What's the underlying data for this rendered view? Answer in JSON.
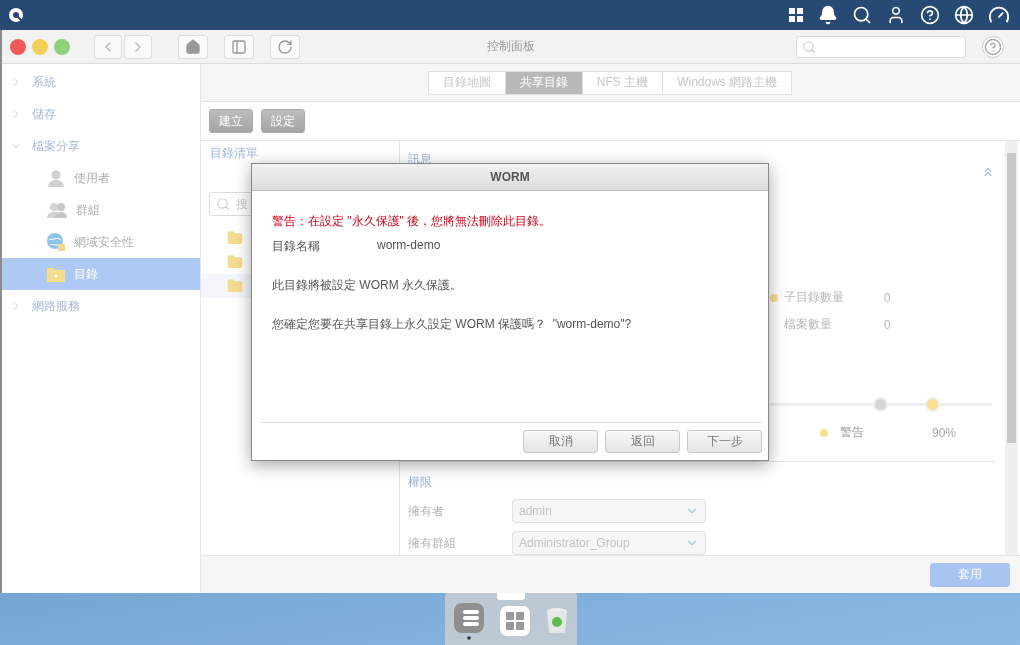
{
  "window": {
    "title": "控制面板"
  },
  "sidebar": {
    "items": [
      {
        "label": "系統",
        "expanded": false,
        "selected": false
      },
      {
        "label": "儲存",
        "expanded": false,
        "selected": false
      },
      {
        "label": "檔案分享",
        "expanded": true,
        "selected": false,
        "children": [
          {
            "label": "使用者",
            "kind": "user",
            "selected": false
          },
          {
            "label": "群組",
            "kind": "group",
            "selected": false
          },
          {
            "label": "網域安全性",
            "kind": "globe",
            "selected": false
          },
          {
            "label": "目錄",
            "kind": "folder",
            "selected": true
          }
        ]
      },
      {
        "label": "網路服務",
        "expanded": false,
        "selected": false
      }
    ]
  },
  "tabs": [
    {
      "label": "目錄地圖",
      "selected": false
    },
    {
      "label": "共享目錄",
      "selected": true
    },
    {
      "label": "NFS 主機",
      "selected": false
    },
    {
      "label": "Windows 網路主機",
      "selected": false
    }
  ],
  "toolbar_buttons": [
    "建立",
    "設定"
  ],
  "directory_list": {
    "title": "目錄清單",
    "search": {
      "placeholder": "搜"
    },
    "folders": [
      {
        "selected": false
      },
      {
        "selected": false
      },
      {
        "selected": true
      }
    ]
  },
  "info": {
    "title": "訊息",
    "stats": [
      {
        "label": "子目錄數量",
        "value": "0"
      },
      {
        "label": "檔案數量",
        "value": "0"
      }
    ],
    "markers": [
      {
        "kind": "limit",
        "level": 0.74
      },
      {
        "kind": "warning",
        "level": 0.86
      }
    ],
    "legend": {
      "label": "警告",
      "value": "90%"
    }
  },
  "permissions": {
    "title": "權限",
    "fields": [
      {
        "label": "擁有者",
        "value": "admin"
      },
      {
        "label": "擁有群組",
        "value": "Administrator_Group"
      }
    ]
  },
  "footer": {
    "apply_button": "套用"
  },
  "dialog": {
    "title": "WORM",
    "warning": "警告：在設定 \"永久保護\" 後，您將無法刪除此目錄。",
    "fields": [
      {
        "label": "目錄名稱",
        "value": "worm-demo"
      }
    ],
    "messages": [
      "此目錄將被設定 WORM 永久保護。",
      "您確定您要在共享目錄上永久設定 WORM 保護嗎？  \"worm-demo\"?"
    ],
    "buttons": [
      "取消",
      "返回",
      "下一步"
    ]
  }
}
